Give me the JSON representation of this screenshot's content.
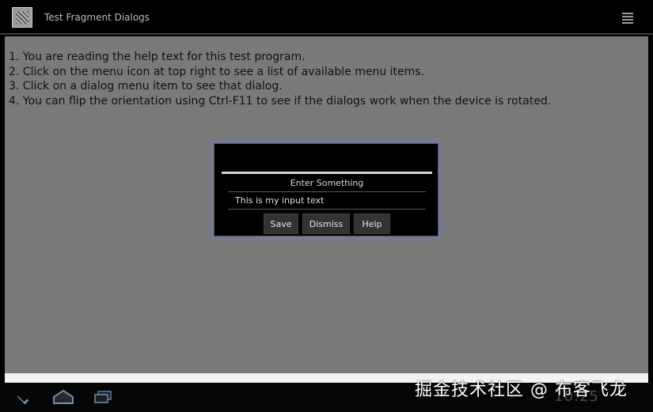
{
  "action_bar": {
    "title": "Test Fragment Dialogs",
    "app_icon": "app-icon",
    "menu_icon": "overflow-menu-icon"
  },
  "help_lines": [
    "1. You are reading the help text for this test program.",
    "2. Click on the menu icon at top right to see a list of available menu items.",
    "3. Click on a dialog menu item to see that dialog.",
    "4. You can flip the orientation using Ctrl-F11 to see if the dialogs work when the device is rotated."
  ],
  "dialog": {
    "title": "Enter Something",
    "input_value": "This is my input text",
    "buttons": {
      "save": "Save",
      "dismiss": "Dismiss",
      "help": "Help"
    }
  },
  "system_bar": {
    "clock": "10:25",
    "back_icon": "back-icon",
    "home_icon": "home-icon",
    "recent_icon": "recent-apps-icon"
  },
  "watermark": "掘金技术社区 @ 布客飞龙",
  "colors": {
    "background": "#7a7a7a",
    "dialog_bg": "#000000",
    "dialog_glow": "#6e78c8",
    "nav_icon": "#6f8db4"
  }
}
